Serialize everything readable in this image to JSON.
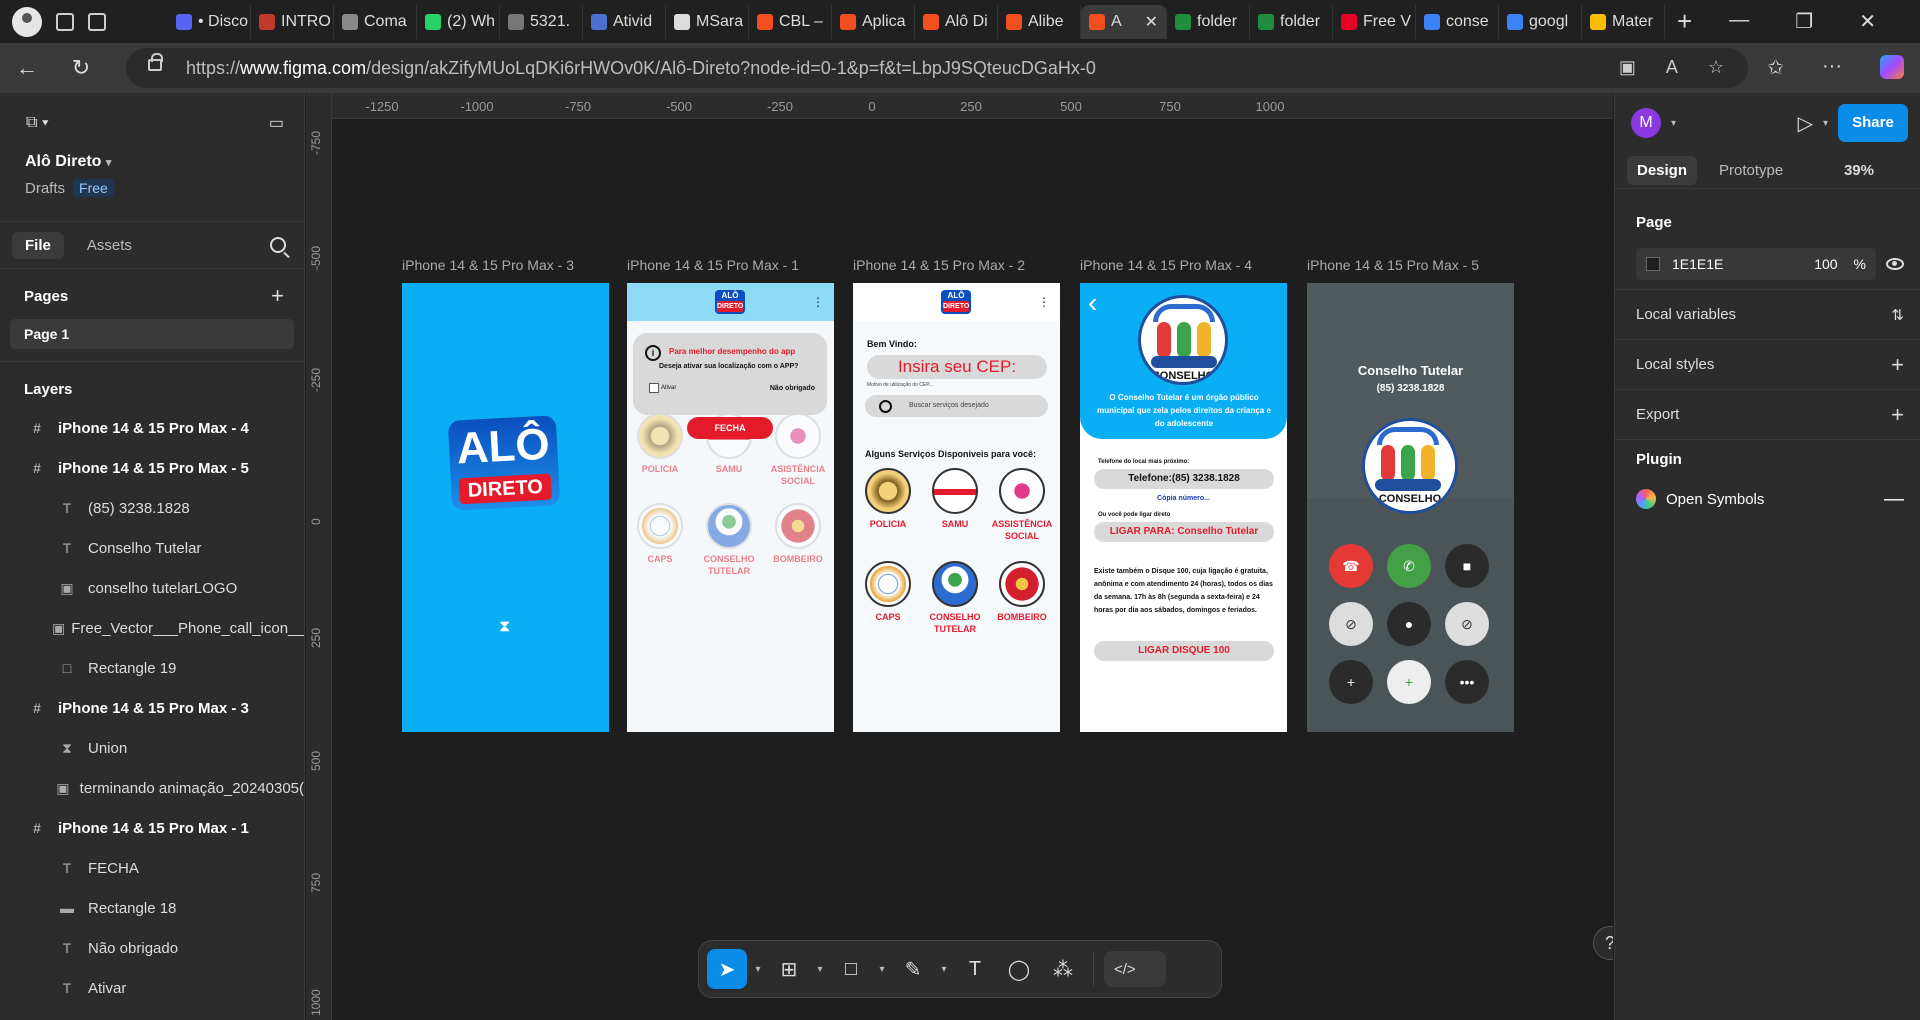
{
  "browser": {
    "tabs": [
      {
        "label": "• Disco",
        "color": "#5865F2"
      },
      {
        "label": "INTRO",
        "color": "#c0392b"
      },
      {
        "label": "Coma",
        "color": "#888888"
      },
      {
        "label": "(2) Wh",
        "color": "#25D366"
      },
      {
        "label": "5321.",
        "color": "#777777"
      },
      {
        "label": "Ativid",
        "color": "#4a6fd1"
      },
      {
        "label": "MSara",
        "color": "#dddddd"
      },
      {
        "label": "CBL –",
        "color": "#F24E1E"
      },
      {
        "label": "Aplica",
        "color": "#F24E1E"
      },
      {
        "label": "Alô Di",
        "color": "#F24E1E"
      },
      {
        "label": "Alibe",
        "color": "#F24E1E"
      },
      {
        "label": "A",
        "color": "#F24E1E"
      },
      {
        "label": "folder",
        "color": "#1e8e3e"
      },
      {
        "label": "folder",
        "color": "#1e8e3e"
      },
      {
        "label": "Free V",
        "color": "#E60023"
      },
      {
        "label": "conse",
        "color": "#3b82f6"
      },
      {
        "label": "googl",
        "color": "#3b82f6"
      },
      {
        "label": "Mater",
        "color": "#fbbc04"
      }
    ],
    "url_prefix": "https://",
    "url_host": "www.figma.com",
    "url_path": "/design/akZifyMUoLqDKi6rHWOv0K/Alô-Direto?node-id=0-1&p=f&t=LbpJ9SQteucDGaHx-0"
  },
  "left_panel": {
    "project_name": "Alô Direto",
    "drafts": "Drafts",
    "plan": "Free",
    "tab_file": "File",
    "tab_assets": "Assets",
    "pages_title": "Pages",
    "page_1": "Page 1",
    "layers_title": "Layers",
    "layers": [
      {
        "type": "frame",
        "label": "iPhone 14 & 15 Pro Max - 4"
      },
      {
        "type": "frame",
        "label": "iPhone 14 & 15 Pro Max - 5"
      },
      {
        "type": "text",
        "label": "(85) 3238.1828"
      },
      {
        "type": "text",
        "label": "Conselho Tutelar"
      },
      {
        "type": "image",
        "label": "conselho tutelarLOGO"
      },
      {
        "type": "image",
        "label": "Free_Vector___Phone_call_icon__s"
      },
      {
        "type": "rect",
        "label": "Rectangle 19"
      },
      {
        "type": "frame",
        "label": "iPhone 14 & 15 Pro Max - 3"
      },
      {
        "type": "union",
        "label": "Union"
      },
      {
        "type": "image",
        "label": "terminando animação_20240305("
      },
      {
        "type": "frame",
        "label": "iPhone 14 & 15 Pro Max - 1"
      },
      {
        "type": "text",
        "label": "FECHA"
      },
      {
        "type": "line",
        "label": "Rectangle 18"
      },
      {
        "type": "text",
        "label": "Não obrigado"
      },
      {
        "type": "text",
        "label": "Ativar"
      }
    ]
  },
  "canvas": {
    "ruler_ticks": [
      "-1250",
      "-1000",
      "-750",
      "-500",
      "-250",
      "0",
      "250",
      "500",
      "750",
      "1000"
    ],
    "ruler_v_ticks": [
      "-750",
      "-500",
      "-250",
      "0",
      "250",
      "500",
      "750",
      "1000"
    ],
    "frame_labels": {
      "f3": "iPhone 14 & 15 Pro Max - 3",
      "f1": "iPhone 14 & 15 Pro Max - 1",
      "f2": "iPhone 14 & 15 Pro Max - 2",
      "f4": "iPhone 14 & 15 Pro Max - 4",
      "f5": "iPhone 14 & 15 Pro Max - 5"
    },
    "splash": {
      "logo_top": "ALÔ",
      "logo_bottom": "DIRETO"
    },
    "mini_logo": {
      "top": "ALÔ",
      "bottom": "DIRETO"
    },
    "permission": {
      "title": "Para melhor desempenho do app",
      "question": "Deseja ativar sua localização com o APP?",
      "activate": "Ativar",
      "decline": "Não obrigado",
      "close": "FECHA"
    },
    "services": [
      "POLICIA",
      "SAMU",
      "ASSISTÊNCIA SOCIAL",
      "CAPS",
      "CONSELHO TUTELAR",
      "BOMBEIRO"
    ],
    "services_p1": [
      "POLICIA",
      "SAMU",
      "ASISTÊNCIA SOCIAL",
      "CAPS",
      "CONSELHO TUTELAR",
      "BOMBEIRO"
    ],
    "home": {
      "welcome": "Bem Vindo:",
      "cep": "Insira seu CEP:",
      "motivo": "Motivo de utilização do CEP...",
      "search": "Buscar serviços desejado",
      "available": "Alguns Serviços Disponiveis para você:"
    },
    "detail": {
      "logo_text": "CONSELHO",
      "description": "O Conselho Tutelar é um órgão público municipal que zela pelos direitos da criança e do adolescente",
      "phone_label": "Telefone do local mais próximo:",
      "phone": "Telefone:(85) 3238.1828",
      "copy": "Cópia número...",
      "direct": "Ou você pode  ligar direto",
      "call": "LIGAR PARA: Conselho Tutelar",
      "info": "Existe também o Disque 100, cuja ligação é gratuita, anônima e com atendimento 24 (horas), todos os dias da semana. 17h às 8h (segunda a sexta-feira) e 24 horas por dia aos sábados, domingos e feriados.",
      "call100": "LIGAR DISQUE 100"
    },
    "call": {
      "title": "Conselho Tutelar",
      "number": "(85) 3238.1828",
      "logo_text": "CONSELHO"
    }
  },
  "toolbar": {
    "tools": [
      "move-tool",
      "frame-tool",
      "shape-tool",
      "pen-tool",
      "text-tool",
      "comment-tool",
      "actions-tool",
      "dev-mode"
    ]
  },
  "right_panel": {
    "avatar": "M",
    "share": "Share",
    "tab_design": "Design",
    "tab_prototype": "Prototype",
    "zoom": "39%",
    "page_title": "Page",
    "bg_color": "1E1E1E",
    "bg_opacity": "100",
    "pct": "%",
    "local_variables": "Local variables",
    "local_styles": "Local styles",
    "export": "Export",
    "plugin": "Plugin",
    "plugin_name": "Open Symbols"
  },
  "help": "?"
}
